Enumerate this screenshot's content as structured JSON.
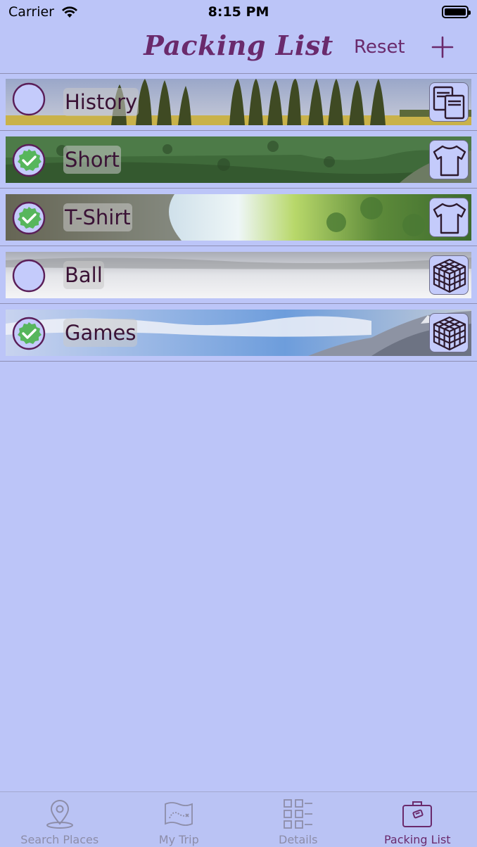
{
  "status_bar": {
    "carrier": "Carrier",
    "time": "8:15 PM"
  },
  "nav": {
    "title": "Packing List",
    "reset_label": "Reset",
    "add_icon": "plus-icon"
  },
  "items": [
    {
      "label": "History",
      "checked": false,
      "category_icon": "books-icon"
    },
    {
      "label": "Short",
      "checked": true,
      "category_icon": "tshirt-icon"
    },
    {
      "label": "T-Shirt",
      "checked": true,
      "category_icon": "tshirt-icon"
    },
    {
      "label": "Ball",
      "checked": false,
      "category_icon": "cube-icon"
    },
    {
      "label": "Games",
      "checked": true,
      "category_icon": "cube-icon"
    }
  ],
  "tabs": [
    {
      "label": "Search Places",
      "icon": "location-pin-icon",
      "active": false
    },
    {
      "label": "My Trip",
      "icon": "map-icon",
      "active": false
    },
    {
      "label": "Details",
      "icon": "qr-icon",
      "active": false
    },
    {
      "label": "Packing List",
      "icon": "suitcase-icon",
      "active": true
    }
  ],
  "colors": {
    "background": "#bcc5f8",
    "accent": "#6a2a6c",
    "check_green": "#57b65c",
    "tab_inactive": "#8d8da8"
  }
}
